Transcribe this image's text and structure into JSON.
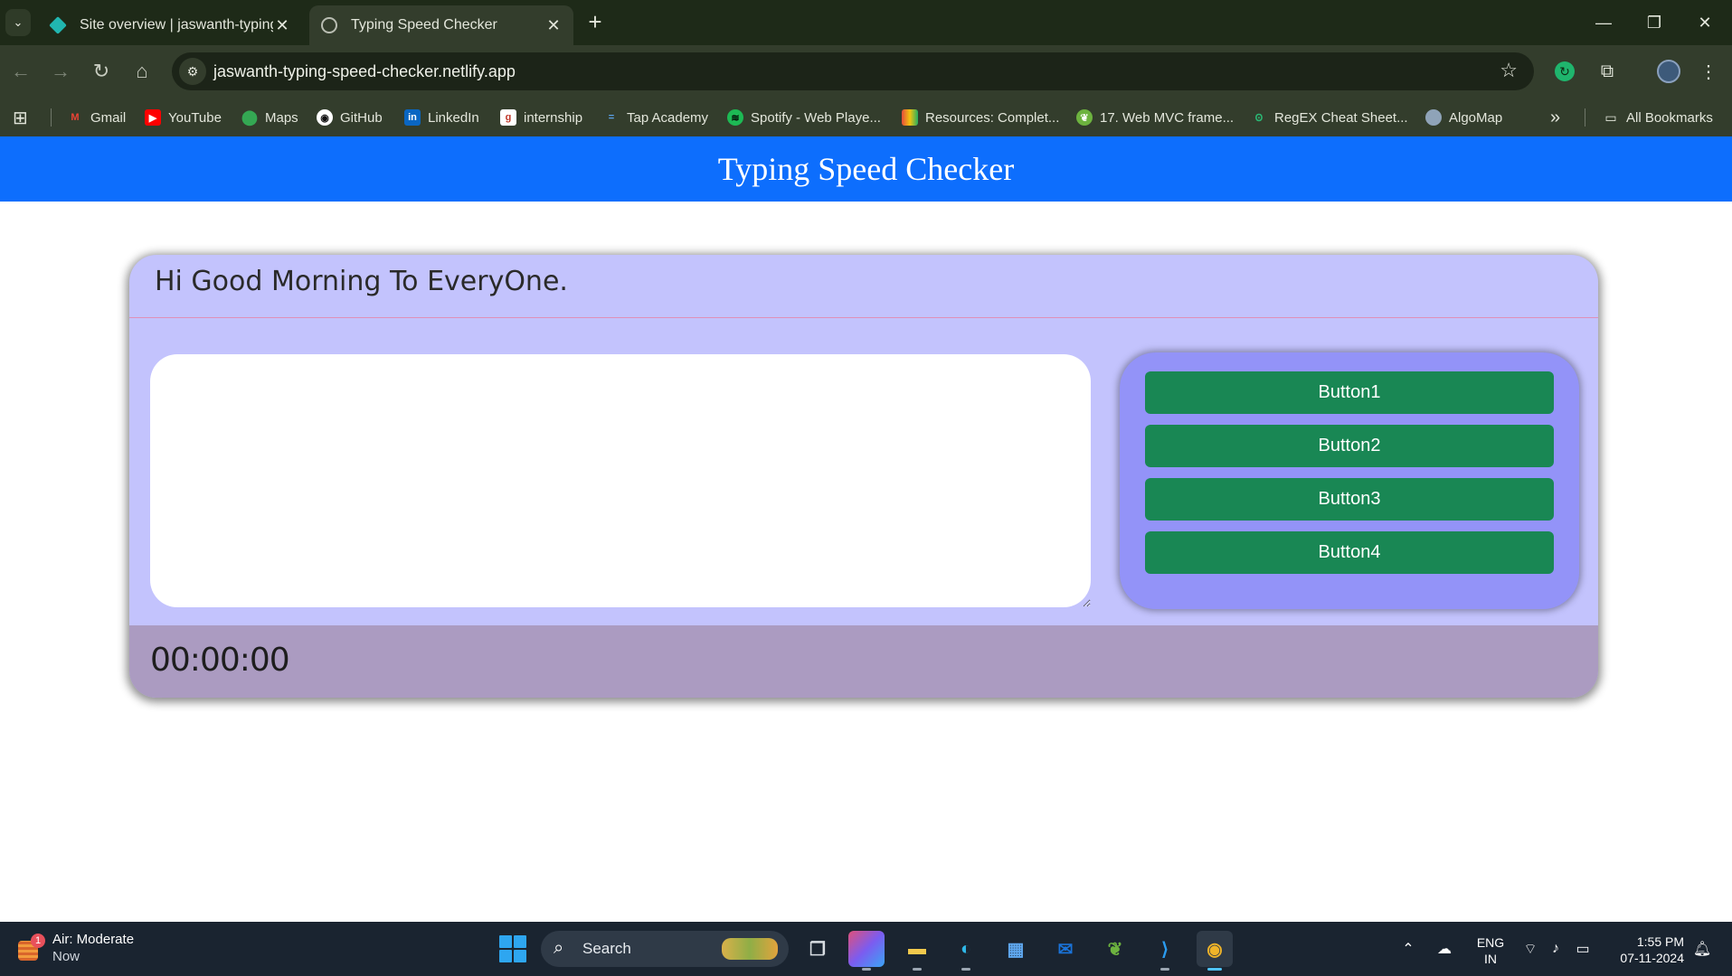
{
  "browser": {
    "tabs": [
      {
        "title": "Site overview | jaswanth-typing",
        "favicon": "netlify-icon"
      },
      {
        "title": "Typing Speed Checker",
        "favicon": "globe-icon"
      }
    ],
    "url": "jaswanth-typing-speed-checker.netlify.app",
    "bookmarks": [
      {
        "label": "Gmail",
        "icon": "gmail-icon",
        "color": "#ea4335"
      },
      {
        "label": "YouTube",
        "icon": "youtube-icon",
        "color": "#ff0000"
      },
      {
        "label": "Maps",
        "icon": "maps-icon",
        "color": "#34a853"
      },
      {
        "label": "GitHub",
        "icon": "github-icon",
        "color": "#ffffff"
      },
      {
        "label": "LinkedIn",
        "icon": "linkedin-icon",
        "color": "#0a66c2"
      },
      {
        "label": "internship",
        "icon": "internship-icon",
        "color": "#ffffff"
      },
      {
        "label": "Tap Academy",
        "icon": "tap-academy-icon",
        "color": "#2b6cb0"
      },
      {
        "label": "Spotify - Web Playe...",
        "icon": "spotify-icon",
        "color": "#1db954"
      },
      {
        "label": "Resources: Complet...",
        "icon": "resources-icon",
        "color": "#e0a020"
      },
      {
        "label": "17. Web MVC frame...",
        "icon": "spring-icon",
        "color": "#6db33f"
      },
      {
        "label": "RegEX Cheat Sheet...",
        "icon": "regex-icon",
        "color": "#2bb673"
      },
      {
        "label": "AlgoMap",
        "icon": "algomap-icon",
        "color": "#8fa3b8"
      }
    ],
    "all_bookmarks_label": "All Bookmarks"
  },
  "page": {
    "header_title": "Typing Speed Checker",
    "sentence": "Hi Good Morning To EveryOne.",
    "textarea_value": "",
    "buttons": [
      "Button1",
      "Button2",
      "Button3",
      "Button4"
    ],
    "timer": "00:00:00",
    "colors": {
      "header": "#0d6efd",
      "card": "#c3c3fd",
      "button_panel": "#9393f8",
      "button": "#198754",
      "timer_bar": "#ab9bc1"
    }
  },
  "taskbar": {
    "weather_title": "Air: Moderate",
    "weather_sub": "Now",
    "weather_badge": "1",
    "search_label": "Search",
    "lang_line1": "ENG",
    "lang_line2": "IN",
    "time": "1:55 PM",
    "date": "07-11-2024"
  }
}
